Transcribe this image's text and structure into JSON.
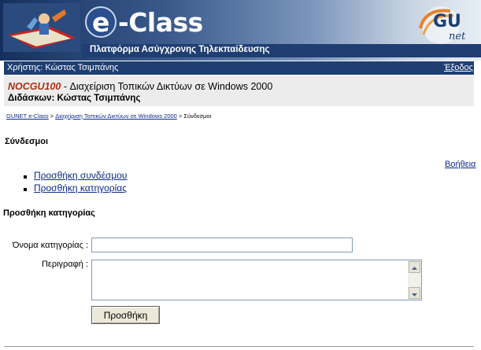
{
  "header": {
    "brand_title": "e-Class",
    "brand_e": "e",
    "brand_rest": "-Class",
    "subtitle": "Πλατφόρμα Ασύγχρονης Τηλεκπαίδευσης",
    "partner_logo_text_main": "GU",
    "partner_logo_text_sub": "net"
  },
  "userbar": {
    "user_text": "Χρήστης: Κώστας Τσιμπάνης",
    "logout_label": "Έξοδος"
  },
  "course": {
    "code": "NOCGU100",
    "title": " - Διαχείριση Τοπικών Δικτύων σε Windows 2000",
    "teachers": "Διδάσκων: Κώστας Τσιμπάνης"
  },
  "breadcrumb": {
    "items": [
      "GUNET e-Class",
      "Διαχείριση Τοπικών Δικτύων σε Windows 2000"
    ],
    "separator": " > ",
    "current": "Σύνδεσμοι"
  },
  "page": {
    "title": "Σύνδεσμοι",
    "help_label": "Βοήθεια"
  },
  "actions": [
    {
      "label": "Προσθήκη συνδέσμου"
    },
    {
      "label": "Προσθήκη κατηγορίας"
    }
  ],
  "form": {
    "heading": "Προσθήκη κατηγορίας",
    "name_label": "Όνομα κατηγορίας :",
    "name_value": "",
    "description_label": "Περιγραφή :",
    "description_value": "",
    "submit_label": "Προσθήκη"
  },
  "colors": {
    "nav_bar": "#1f3f73",
    "course_box": "#ececec",
    "course_code": "#b03010",
    "link": "#0b2a8a"
  }
}
